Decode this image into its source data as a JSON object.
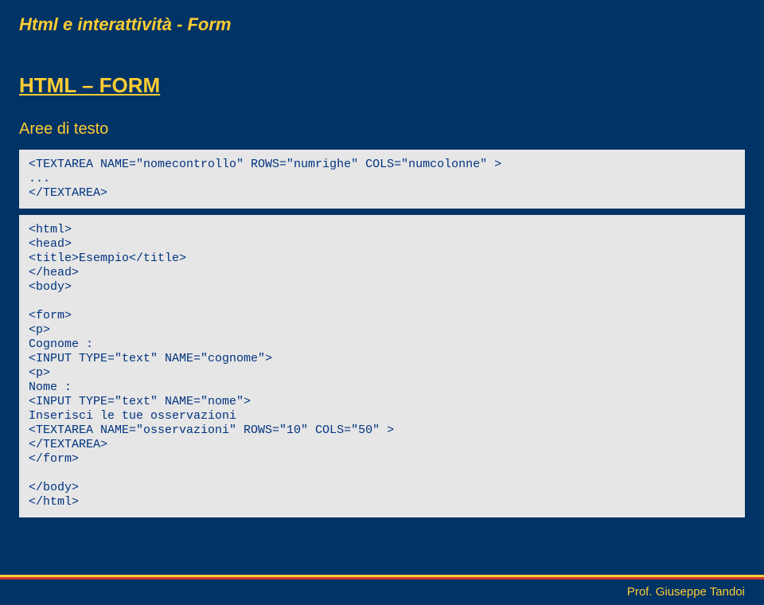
{
  "header": {
    "title": "Html e interattività - Form"
  },
  "section": {
    "heading": "HTML – FORM",
    "subheading": "Aree di testo"
  },
  "code1": "<TEXTAREA NAME=\"nomecontrollo\" ROWS=\"numrighe\" COLS=\"numcolonne\" >\n...\n</TEXTAREA>",
  "code2": "<html>\n<head>\n<title>Esempio</title>\n</head>\n<body>\n\n<form>\n<p>\nCognome :\n<INPUT TYPE=\"text\" NAME=\"cognome\">\n<p>\nNome :\n<INPUT TYPE=\"text\" NAME=\"nome\">\nInserisci le tue osservazioni\n<TEXTAREA NAME=\"osservazioni\" ROWS=\"10\" COLS=\"50\" >\n</TEXTAREA>\n</form>\n\n</body>\n</html>",
  "footer": {
    "author": "Prof. Giuseppe Tandoi"
  }
}
